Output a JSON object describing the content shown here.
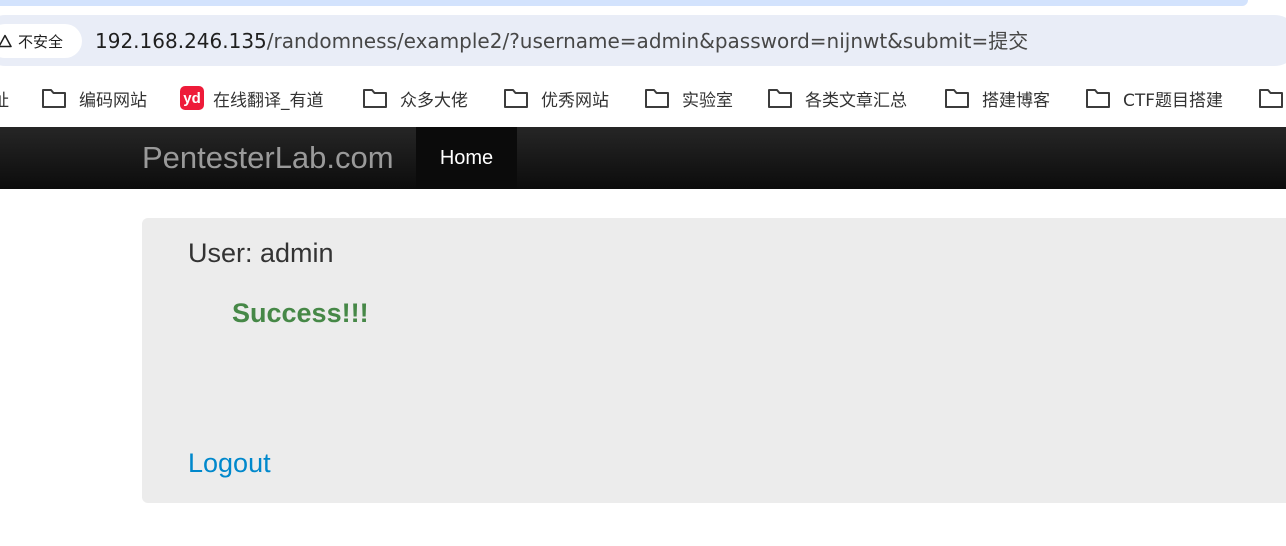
{
  "browser": {
    "security_label": "不安全",
    "url": {
      "host": "192.168.246.135",
      "path": "/randomness/example2/?username=admin&password=nijnwt&submit=提交"
    },
    "bookmarks": [
      {
        "label": "址",
        "icon": "none"
      },
      {
        "label": "编码网站",
        "icon": "folder-icon"
      },
      {
        "label": "在线翻译_有道",
        "icon": "youdao-icon",
        "icon_text": "yd"
      },
      {
        "label": "众多大佬",
        "icon": "folder-icon"
      },
      {
        "label": "优秀网站",
        "icon": "folder-icon"
      },
      {
        "label": "实验室",
        "icon": "folder-icon"
      },
      {
        "label": "各类文章汇总",
        "icon": "folder-icon"
      },
      {
        "label": "搭建博客",
        "icon": "folder-icon"
      },
      {
        "label": "CTF题目搭建",
        "icon": "folder-icon"
      },
      {
        "label": "",
        "icon": "folder-icon"
      }
    ]
  },
  "site": {
    "brand": "PentesterLab.com",
    "nav": {
      "home_label": "Home"
    },
    "user_line": "User: admin",
    "message": "Success!!!",
    "logout_label": "Logout"
  },
  "colors": {
    "success": "#468847",
    "link": "#0088cc",
    "navbar": "#1a1a1a",
    "panel": "#ececec"
  }
}
